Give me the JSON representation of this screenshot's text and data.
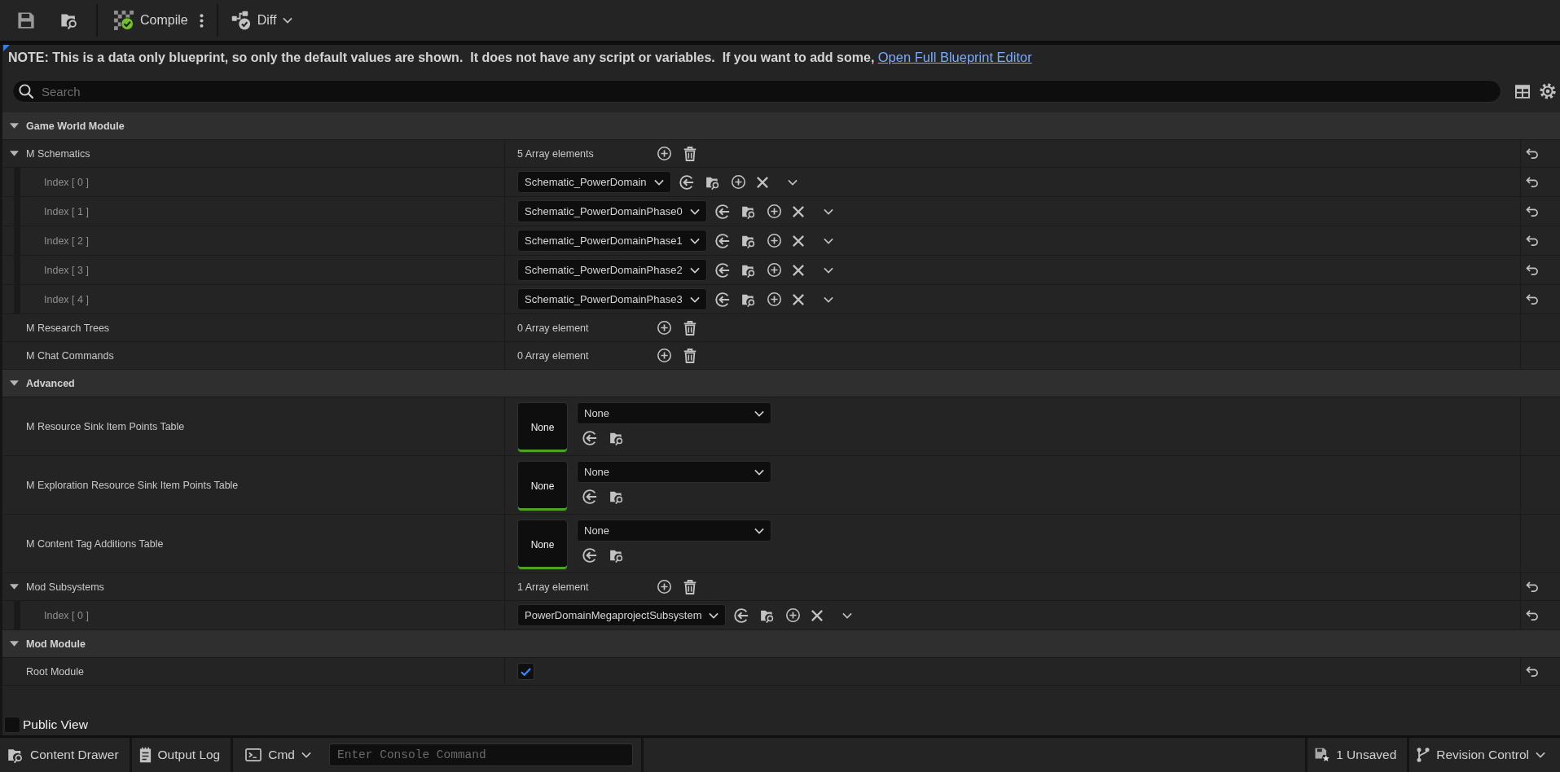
{
  "toolbar": {
    "compile": {
      "label": "Compile",
      "compiled": true
    },
    "diff": {
      "label": "Diff"
    }
  },
  "note": {
    "text": "NOTE: This is a data only blueprint, so only the default values are shown.  It does not have any script or variables.  If you want to add some,",
    "link": "Open Full Blueprint Editor"
  },
  "search": {
    "placeholder": "Search"
  },
  "categories": [
    {
      "title": "Game World Module",
      "expanded": true,
      "rows": [
        {
          "kind": "array",
          "name": "M Schematics",
          "expanded": true,
          "count": "5 Array elements",
          "reset": true,
          "elements": [
            {
              "label": "Index [ 0 ]",
              "value": "Schematic_PowerDomain",
              "reset": true
            },
            {
              "label": "Index [ 1 ]",
              "value": "Schematic_PowerDomainPhase0",
              "reset": true
            },
            {
              "label": "Index [ 2 ]",
              "value": "Schematic_PowerDomainPhase1",
              "reset": true
            },
            {
              "label": "Index [ 3 ]",
              "value": "Schematic_PowerDomainPhase2",
              "reset": true
            },
            {
              "label": "Index [ 4 ]",
              "value": "Schematic_PowerDomainPhase3",
              "reset": true
            }
          ]
        },
        {
          "kind": "array",
          "name": "M Research Trees",
          "count": "0 Array element",
          "reset": false
        },
        {
          "kind": "array",
          "name": "M Chat Commands",
          "count": "0 Array element",
          "reset": false
        }
      ]
    },
    {
      "title": "Advanced",
      "expanded": true,
      "rows": [
        {
          "kind": "asset",
          "name": "M Resource Sink Item Points Table",
          "thumbnail": "None",
          "value": "None",
          "reset": false
        },
        {
          "kind": "asset",
          "name": "M Exploration Resource Sink Item Points Table",
          "thumbnail": "None",
          "value": "None",
          "reset": false
        },
        {
          "kind": "asset",
          "name": "M Content Tag Additions Table",
          "thumbnail": "None",
          "value": "None",
          "reset": false
        },
        {
          "kind": "array",
          "name": "Mod Subsystems",
          "expanded": true,
          "count": "1 Array element",
          "reset": true,
          "elements": [
            {
              "label": "Index [ 0 ]",
              "value": "PowerDomainMegaprojectSubsystem",
              "reset": true
            }
          ]
        }
      ]
    },
    {
      "title": "Mod Module",
      "expanded": true,
      "rows": [
        {
          "kind": "bool",
          "name": "Root Module",
          "checked": true,
          "reset": true
        }
      ]
    }
  ],
  "public_view": {
    "label": "Public View",
    "checked": false
  },
  "status_bar": {
    "content_drawer": "Content Drawer",
    "output_log": "Output Log",
    "cmd": "Cmd",
    "console": {
      "placeholder": "Enter Console Command"
    },
    "unsaved": "1 Unsaved",
    "revision_control": "Revision Control"
  }
}
